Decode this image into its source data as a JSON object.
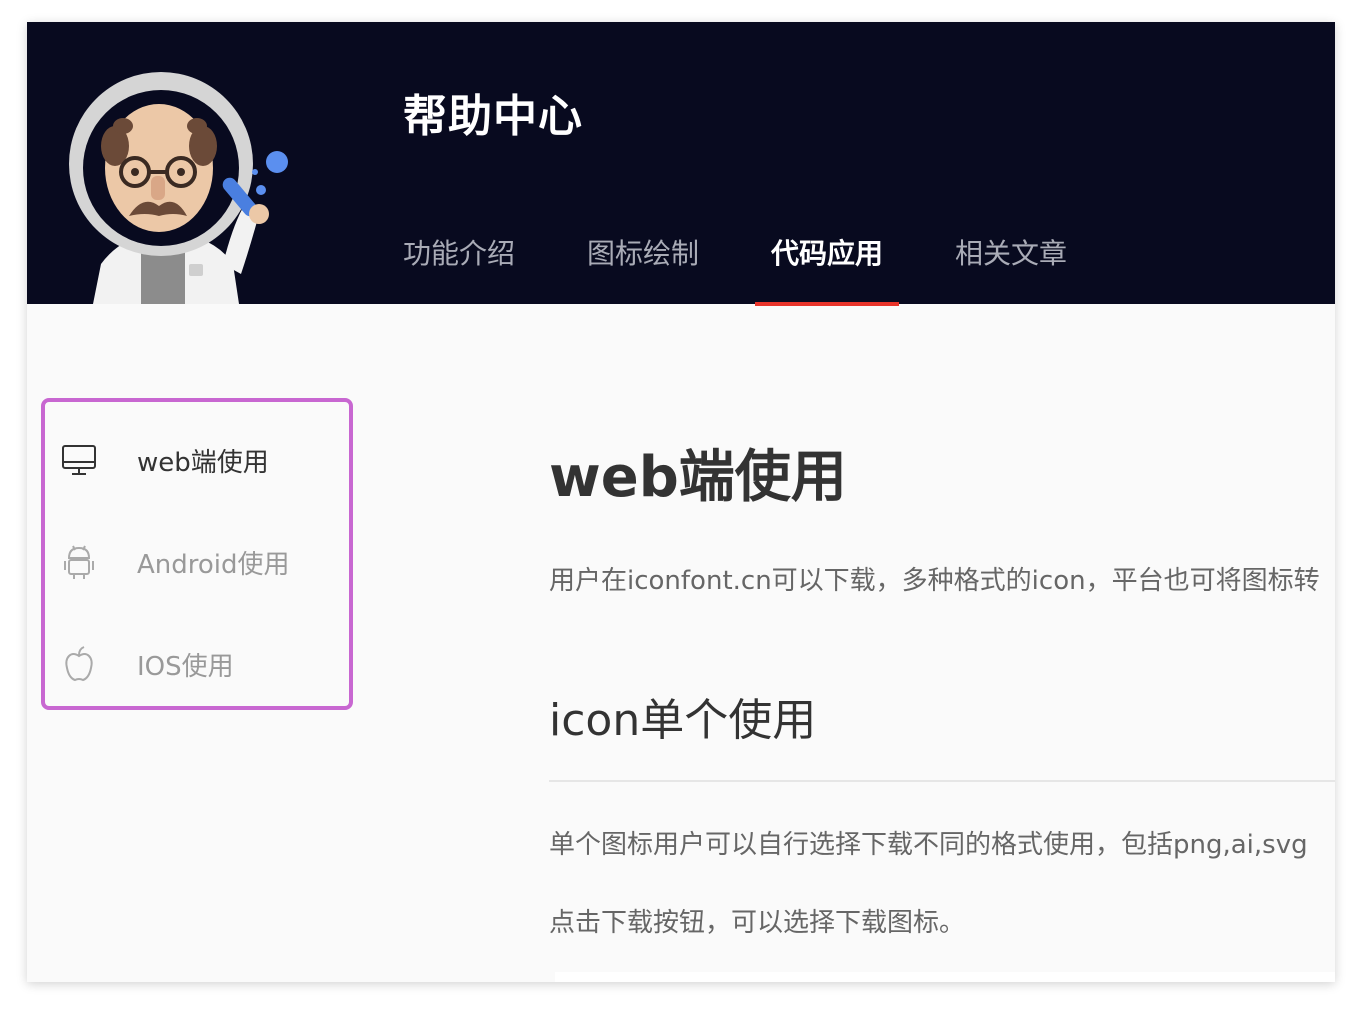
{
  "header": {
    "title": "帮助中心",
    "nav": [
      {
        "label": "功能介绍",
        "active": false
      },
      {
        "label": "图标绘制",
        "active": false
      },
      {
        "label": "代码应用",
        "active": true
      },
      {
        "label": "相关文章",
        "active": false
      }
    ],
    "accent_color": "#e8342a",
    "background_color": "#080a1f"
  },
  "sidebar": {
    "border_color": "#c867d1",
    "items": [
      {
        "label": "web端使用",
        "icon": "desktop-icon",
        "active": true
      },
      {
        "label": "Android使用",
        "icon": "android-icon",
        "active": false
      },
      {
        "label": "IOS使用",
        "icon": "apple-icon",
        "active": false
      }
    ]
  },
  "main": {
    "heading": "web端使用",
    "intro": "用户在iconfont.cn可以下载，多种格式的icon，平台也可将图标转",
    "section_heading": "icon单个使用",
    "paragraph1": "单个图标用户可以自行选择下载不同的格式使用，包括png,ai,svg",
    "paragraph2": "点击下载按钮，可以选择下载图标。"
  }
}
